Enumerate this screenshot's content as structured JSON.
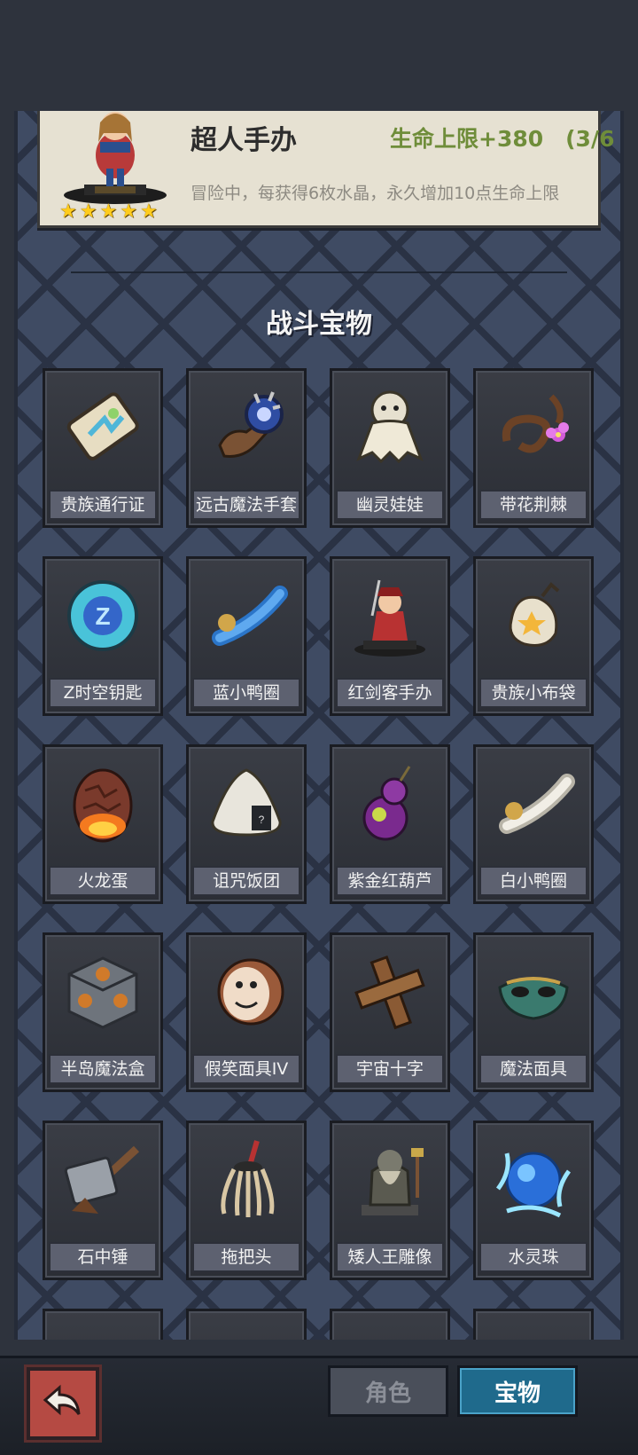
{
  "card": {
    "title": "超人手办",
    "bonus": "生命上限+380　(3/6",
    "description": "冒险中，每获得6枚水晶，永久增加10点生命上限",
    "stars": 5
  },
  "section_title": "战斗宝物",
  "items": [
    {
      "label": "贵族通行证",
      "icon": "card-icon"
    },
    {
      "label": "远古魔法手套",
      "icon": "gauntlet-icon"
    },
    {
      "label": "幽灵娃娃",
      "icon": "ghost-doll-icon"
    },
    {
      "label": "带花荆棘",
      "icon": "thorn-flower-icon"
    },
    {
      "label": "Z时空钥匙",
      "icon": "z-orb-icon"
    },
    {
      "label": "蓝小鸭圈",
      "icon": "blue-duck-ring-icon"
    },
    {
      "label": "红剑客手办",
      "icon": "swordsman-figure-icon"
    },
    {
      "label": "贵族小布袋",
      "icon": "cloth-bag-icon"
    },
    {
      "label": "火龙蛋",
      "icon": "dragon-egg-icon"
    },
    {
      "label": "诅咒饭团",
      "icon": "rice-ball-icon"
    },
    {
      "label": "紫金红葫芦",
      "icon": "gourd-icon"
    },
    {
      "label": "白小鸭圈",
      "icon": "white-duck-ring-icon"
    },
    {
      "label": "半岛魔法盒",
      "icon": "magic-box-icon"
    },
    {
      "label": "假笑面具IV",
      "icon": "smile-mask-icon"
    },
    {
      "label": "宇宙十字",
      "icon": "cross-icon"
    },
    {
      "label": "魔法面具",
      "icon": "magic-mask-icon"
    },
    {
      "label": "石中锤",
      "icon": "hammer-icon"
    },
    {
      "label": "拖把头",
      "icon": "mop-icon"
    },
    {
      "label": "矮人王雕像",
      "icon": "dwarf-statue-icon"
    },
    {
      "label": "水灵珠",
      "icon": "water-orb-icon"
    }
  ],
  "tabs": {
    "role": "角色",
    "treasure": "宝物"
  },
  "colors": {
    "bonus": "#6f8d3a",
    "active_tab": "#1f6a8c",
    "back_button": "#b54a43"
  }
}
